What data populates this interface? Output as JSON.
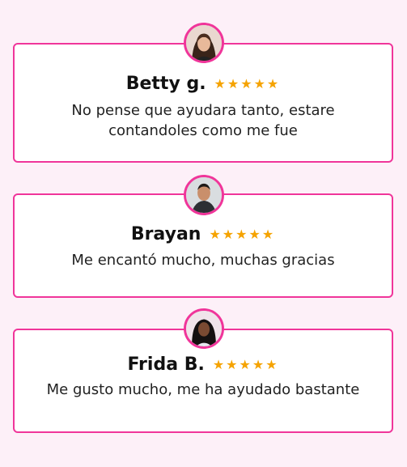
{
  "reviews": [
    {
      "name": "Betty g.",
      "stars": "★★★★★",
      "text": "No pense que ayudara tanto, estare contandoles como me fue"
    },
    {
      "name": "Brayan",
      "stars": "★★★★★",
      "text": "Me encantó mucho, muchas gracias"
    },
    {
      "name": "Frida B.",
      "stars": "★★★★★",
      "text": "Me gusto mucho, me ha ayudado bastante"
    }
  ],
  "colors": {
    "accent": "#f0359a",
    "star": "#f5a300",
    "background": "#fdf0f8"
  }
}
